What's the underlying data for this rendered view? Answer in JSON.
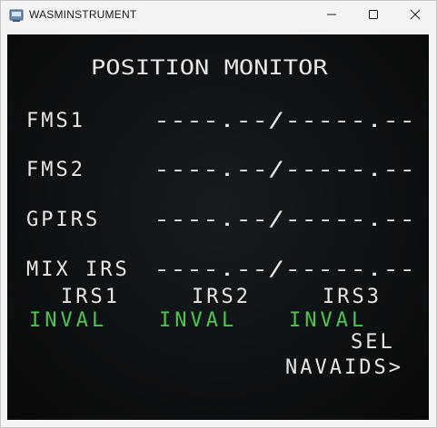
{
  "window": {
    "title": "WASMINSTRUMENT",
    "app_icon": "app-icon",
    "controls": [
      "minimize-icon",
      "maximize-icon",
      "close-icon"
    ]
  },
  "cdu": {
    "page_title": "POSITION MONITOR",
    "rows": [
      {
        "label": "FMS1",
        "value": "----.--/-----.--"
      },
      {
        "label": "FMS2",
        "value": "----.--/-----.--"
      },
      {
        "label": "GPIRS",
        "value": "----.--/-----.--"
      },
      {
        "label": "MIX IRS",
        "value": "----.--/-----.--"
      }
    ],
    "irs_headers": [
      "IRS1",
      "IRS2",
      "IRS3"
    ],
    "irs_status": [
      "INVAL",
      "INVAL",
      "INVAL"
    ],
    "sel_label": "SEL",
    "navaids_label": "NAVAIDS>"
  },
  "colors": {
    "screen_background": "#0e1113",
    "text_white": "#e6e6e6",
    "text_green": "#4fc44f"
  }
}
